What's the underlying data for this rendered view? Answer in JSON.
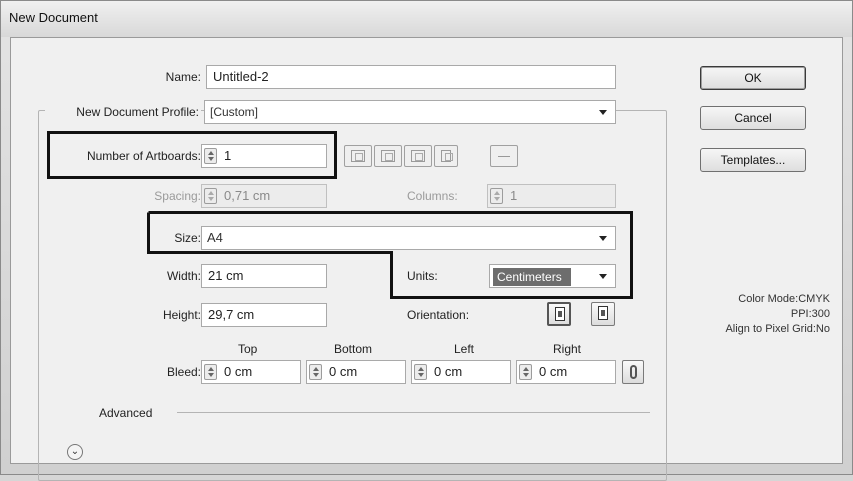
{
  "window": {
    "title": "New Document"
  },
  "name": {
    "label": "Name:",
    "value": "Untitled-2"
  },
  "profile": {
    "label": "New Document Profile:",
    "value": "[Custom]"
  },
  "artboards": {
    "label": "Number of Artboards:",
    "value": "1"
  },
  "spacing": {
    "label": "Spacing:",
    "value": "0,71 cm"
  },
  "columns": {
    "label": "Columns:",
    "value": "1"
  },
  "size": {
    "label": "Size:",
    "value": "A4"
  },
  "width": {
    "label": "Width:",
    "value": "21 cm"
  },
  "height": {
    "label": "Height:",
    "value": "29,7 cm"
  },
  "units": {
    "label": "Units:",
    "value": "Centimeters"
  },
  "orientation": {
    "label": "Orientation:"
  },
  "bleed": {
    "label": "Bleed:",
    "top_label": "Top",
    "top": "0 cm",
    "bottom_label": "Bottom",
    "bottom": "0 cm",
    "left_label": "Left",
    "left": "0 cm",
    "right_label": "Right",
    "right": "0 cm"
  },
  "advanced": {
    "label": "Advanced"
  },
  "buttons": {
    "ok": "OK",
    "cancel": "Cancel",
    "templates": "Templates..."
  },
  "info": {
    "color_mode": "Color Mode:CMYK",
    "ppi": "PPI:300",
    "align": "Align to Pixel Grid:No"
  }
}
